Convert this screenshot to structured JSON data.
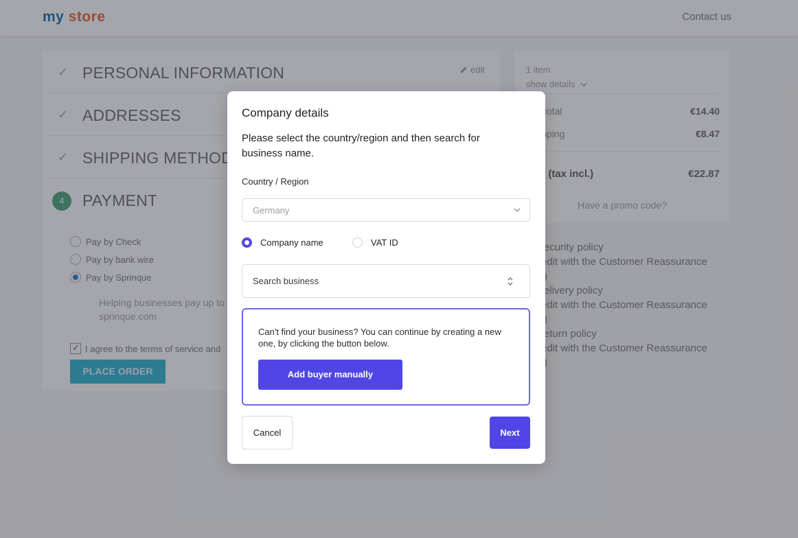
{
  "header": {
    "logo_my": "my",
    "logo_store": "store",
    "contact": "Contact us"
  },
  "steps": {
    "personal": "PERSONAL INFORMATION",
    "edit": "edit",
    "addresses": "ADDRESSES",
    "shipping": "SHIPPING METHOD",
    "payment_number": "4",
    "payment": "PAYMENT"
  },
  "payment_options": [
    {
      "label": "Pay by Check",
      "selected": false
    },
    {
      "label": "Pay by bank wire",
      "selected": false
    },
    {
      "label": "Pay by Sprinque",
      "selected": true
    }
  ],
  "payment_help": "Helping businesses pay up to ... sprinque.com",
  "payment_help_line1": "Helping businesses pay up to",
  "payment_help_line2": "sprinque.com",
  "terms": "I agree to the terms of service and",
  "place_order": "PLACE ORDER",
  "summary": {
    "count": "1 item",
    "show_details": "show details",
    "subtotal_label": "Subtotal",
    "subtotal_visible": "total",
    "subtotal": "€14.40",
    "shipping_label": "Shipping",
    "shipping_visible": "pping",
    "shipping": "€8.47",
    "total_label": "Total (tax incl.)",
    "total_visible": "l (tax incl.)",
    "total": "€22.87",
    "promo": "Have a promo code?"
  },
  "reassurance": [
    {
      "title": "ecurity policy",
      "line2": "edit with the Customer Reassurance",
      "line3": ")"
    },
    {
      "title": "elivery policy",
      "line2": "edit with the Customer Reassurance",
      "line3": ")"
    },
    {
      "title": "eturn policy",
      "line2": "edit with the Customer Reassurance",
      "line3": ")"
    }
  ],
  "modal": {
    "title": "Company details",
    "description": "Please select the country/region and then search for business name.",
    "country_label": "Country / Region",
    "country_value": "Germany",
    "radio_company": "Company name",
    "radio_vat": "VAT ID",
    "search_placeholder": "Search business",
    "not_found_text": "Can't find your business? You can continue by creating a new one, by clicking the button below.",
    "add_buyer": "Add buyer manually",
    "cancel": "Cancel",
    "next": "Next"
  },
  "colors": {
    "accent": "#4f46e5",
    "place_order": "#2fb5d2",
    "step_done": "#4aa67a"
  }
}
